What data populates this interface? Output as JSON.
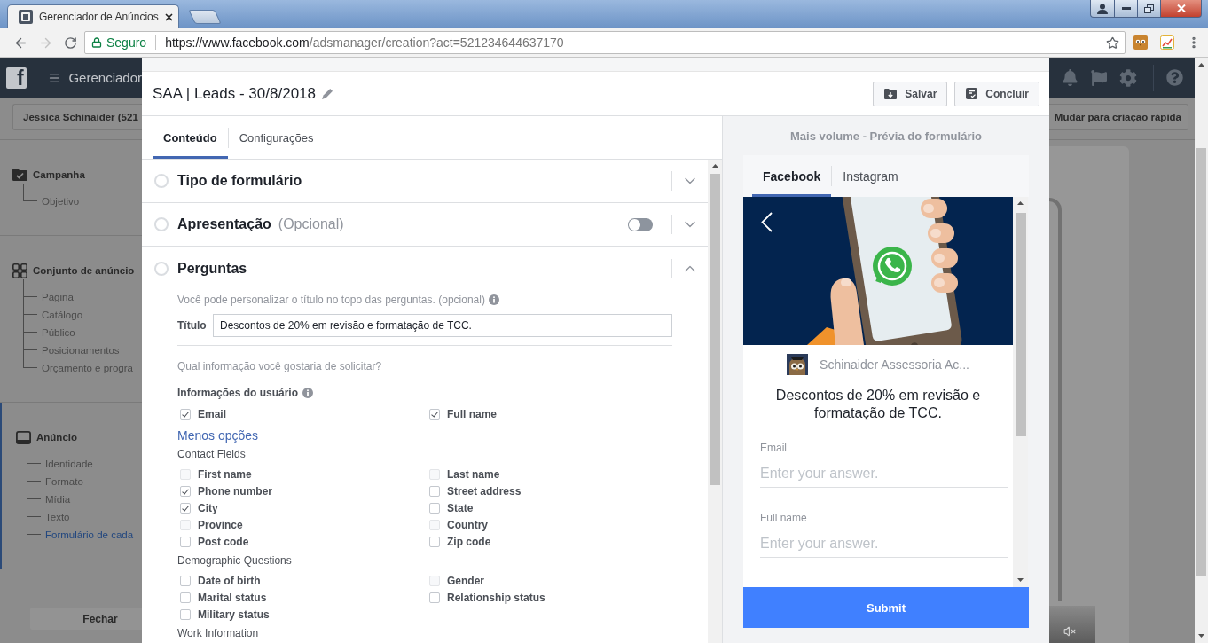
{
  "browser": {
    "tab": {
      "title": "Gerenciador de Anúncios",
      "selected": true
    },
    "address": {
      "security": "Seguro",
      "host": "https://www.facebook.com",
      "path": "/adsmanager/creation?act=521234644637170"
    }
  },
  "app_bar": {
    "logo": "f",
    "title": "Gerenciador"
  },
  "account_button": "Jessica Schinaider (521",
  "quick_create_button": "Mudar para criação rápida",
  "sidebar": {
    "sections": [
      {
        "kind": "campaign",
        "title": "Campanha",
        "active": false,
        "children": [
          {
            "label": "Objetivo",
            "selected": false
          }
        ]
      },
      {
        "kind": "ad_set",
        "title": "Conjunto de anúncio",
        "active": false,
        "children": [
          {
            "label": "Página",
            "selected": false
          },
          {
            "label": "Catálogo",
            "selected": false
          },
          {
            "label": "Público",
            "selected": false
          },
          {
            "label": "Posicionamentos",
            "selected": false
          },
          {
            "label": "Orçamento e progra",
            "selected": false
          }
        ]
      },
      {
        "kind": "ad",
        "title": "Anúncio",
        "active": true,
        "children": [
          {
            "label": "Identidade",
            "selected": false
          },
          {
            "label": "Formato",
            "selected": false
          },
          {
            "label": "Mídia",
            "selected": false
          },
          {
            "label": "Texto",
            "selected": false
          },
          {
            "label": "Formulário de cada",
            "selected": true
          }
        ]
      }
    ],
    "close_button": "Fechar"
  },
  "modal": {
    "title": "SAA | Leads - 30/8/2018",
    "actions": [
      {
        "kind": "save",
        "label": "Salvar"
      },
      {
        "kind": "finish",
        "label": "Concluir"
      }
    ],
    "tabs": [
      {
        "label": "Conteúdo",
        "selected": true
      },
      {
        "label": "Configurações",
        "selected": false
      }
    ],
    "sections": [
      {
        "title": "Tipo de formulário",
        "checked": false,
        "expanded": false
      },
      {
        "title": "Apresentação",
        "note": "(Opcional)",
        "checked": false,
        "expanded": false,
        "toggle": {
          "on": false
        }
      },
      {
        "title": "Perguntas",
        "checked": false,
        "expanded": true
      }
    ],
    "questions": {
      "hint": "Você pode personalizar o título no topo das perguntas. (opcional)",
      "title_label": "Título",
      "title_value": "Descontos de 20% em revisão e formatação de TCC.",
      "prompt": "Qual informação você gostaria de solicitar?",
      "user_info": {
        "label": "Informações do usuário",
        "fields": [
          {
            "label": "Email",
            "checked": true,
            "disabled": false
          },
          {
            "label": "Full name",
            "checked": true,
            "disabled": false
          }
        ]
      },
      "less_options": "Menos opções",
      "groups": [
        {
          "title": "Contact Fields",
          "fields": [
            {
              "label": "First name",
              "checked": false,
              "disabled": true
            },
            {
              "label": "Last name",
              "checked": false,
              "disabled": true
            },
            {
              "label": "Phone number",
              "checked": true,
              "disabled": false
            },
            {
              "label": "Street address",
              "checked": false,
              "disabled": false
            },
            {
              "label": "City",
              "checked": true,
              "disabled": false
            },
            {
              "label": "State",
              "checked": false,
              "disabled": false
            },
            {
              "label": "Province",
              "checked": false,
              "disabled": true
            },
            {
              "label": "Country",
              "checked": false,
              "disabled": true
            },
            {
              "label": "Post code",
              "checked": false,
              "disabled": false
            },
            {
              "label": "Zip code",
              "checked": false,
              "disabled": false
            }
          ]
        },
        {
          "title": "Demographic Questions",
          "fields": [
            {
              "label": "Date of birth",
              "checked": false,
              "disabled": false
            },
            {
              "label": "Gender",
              "checked": false,
              "disabled": true
            },
            {
              "label": "Marital status",
              "checked": false,
              "disabled": false
            },
            {
              "label": "Relationship status",
              "checked": false,
              "disabled": false
            },
            {
              "label": "Military status",
              "checked": false,
              "disabled": false
            }
          ]
        },
        {
          "title": "Work Information"
        }
      ]
    }
  },
  "preview": {
    "title": "Mais volume - Prévia do formulário",
    "tabs": [
      {
        "label": "Facebook",
        "selected": true
      },
      {
        "label": "Instagram",
        "selected": false
      }
    ],
    "page_name": "Schinaider Assessoria Ac...",
    "headline": "Descontos de 20% em revisão e formatação de TCC.",
    "fields": [
      {
        "label": "Email",
        "placeholder": "Enter your answer."
      },
      {
        "label": "Full name",
        "placeholder": "Enter your answer."
      }
    ],
    "submit": "Submit"
  }
}
